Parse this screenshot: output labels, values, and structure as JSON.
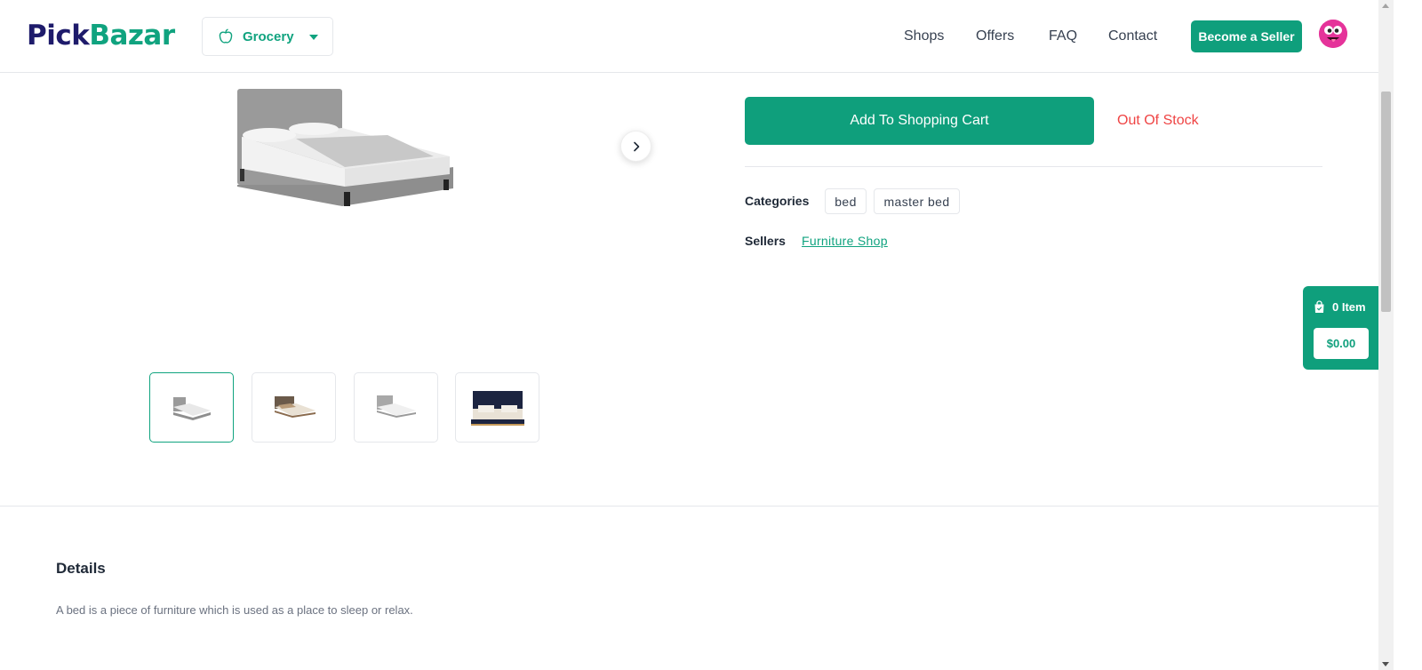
{
  "header": {
    "logo_part1": "Pick",
    "logo_part2": "Bazar",
    "shop_type": "Grocery",
    "nav": [
      "Shops",
      "Offers",
      "FAQ",
      "Contact"
    ],
    "become_seller": "Become a Seller"
  },
  "product": {
    "add_to_cart": "Add To Shopping Cart",
    "stock_status": "Out Of Stock",
    "categories_label": "Categories",
    "categories": [
      "bed",
      "master bed"
    ],
    "sellers_label": "Sellers",
    "seller": "Furniture Shop"
  },
  "floating_cart": {
    "items": "0 Item",
    "total": "$0.00"
  },
  "details": {
    "title": "Details",
    "text": "A bed is a piece of furniture which is used as a place to sleep or relax."
  },
  "colors": {
    "accent": "#0f9f7c",
    "brand_dark": "#1e1b6b",
    "out_of_stock": "#ef4444"
  }
}
